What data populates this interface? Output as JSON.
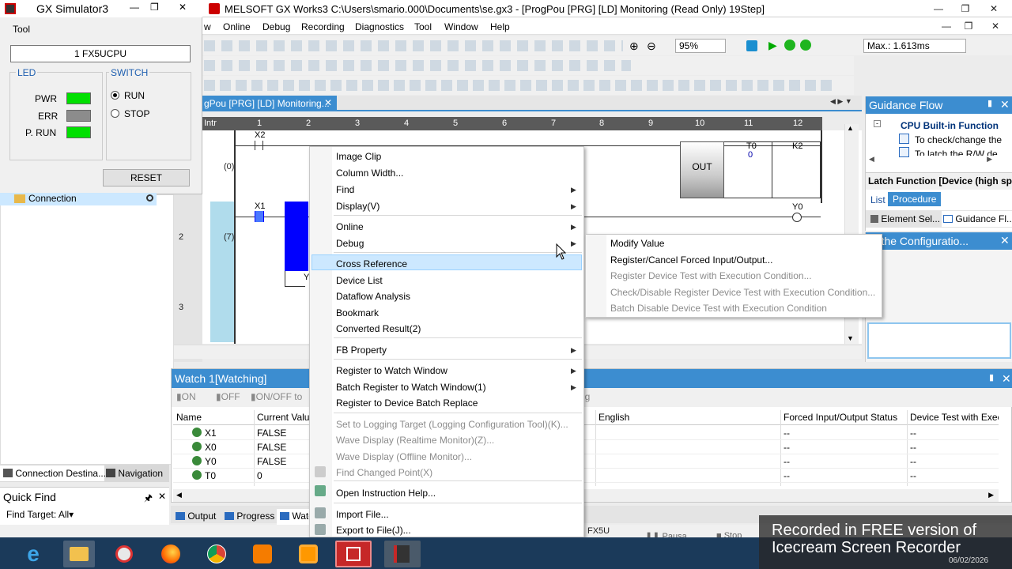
{
  "main_window": {
    "title": "MELSOFT GX Works3 C:\\Users\\smario.000\\Documents\\se.gx3 - [ProgPou [PRG] [LD] Monitoring (Read Only) 19Step]",
    "menu_items": [
      "w",
      "Online",
      "Debug",
      "Recording",
      "Diagnostics",
      "Tool",
      "Window",
      "Help"
    ],
    "zoom": "95%",
    "scan_time": "Max.: 1.613ms"
  },
  "simulator": {
    "title": "GX Simulator3",
    "tool_label": "Tool",
    "cpu": "1  FX5UCPU",
    "led_group": "LED",
    "switch_group": "SWITCH",
    "leds": [
      {
        "label": "PWR",
        "color": "#00e000"
      },
      {
        "label": "ERR",
        "color": "#8c8c8c"
      },
      {
        "label": "P. RUN",
        "color": "#00e000"
      }
    ],
    "run_label": "RUN",
    "stop_label": "STOP",
    "reset_label": "RESET"
  },
  "connection_item": "Connection",
  "tab": "gPou [PRG] [LD] Monitoring...",
  "ladder": {
    "ruler_first": "Intr",
    "columns": [
      "1",
      "2",
      "3",
      "4",
      "5",
      "6",
      "7",
      "8",
      "9",
      "10",
      "11",
      "12"
    ],
    "rows": [
      {
        "num": "1",
        "step": "(0)"
      },
      {
        "num": "2",
        "step": "(7)"
      },
      {
        "num": "3",
        "step": ""
      }
    ],
    "contact_x2": "X2",
    "contact_x1": "X1",
    "coil_y0": "Y0",
    "y_partial": "Y",
    "out_block": "OUT",
    "t0_label": "T0",
    "t0_value": "0",
    "k2_label": "K2"
  },
  "guidance": {
    "title": "Guidance Flow",
    "tree_root": "CPU Built-in Function",
    "tree_items": [
      "To check/change the",
      "To latch the R/W de"
    ],
    "heading": "Latch Function [Device (high speed",
    "tabs": [
      "List",
      "Procedure"
    ],
    "bottom_tabs": [
      "Element Sel...",
      "Guidance Fl..."
    ],
    "config_title": "ut the Configuratio..."
  },
  "watch": {
    "title": "Watch 1[Watching]",
    "toolbar": [
      "ON",
      "OFF",
      "ON/OFF to",
      "ng"
    ],
    "columns_left": [
      "Name",
      "Current Value"
    ],
    "columns_right": [
      "English",
      "Forced Input/Output Status",
      "Device Test with Exec"
    ],
    "rows": [
      {
        "name": "X1",
        "value": "FALSE",
        "forced": "--",
        "test": "--"
      },
      {
        "name": "X0",
        "value": "FALSE",
        "forced": "--",
        "test": "--"
      },
      {
        "name": "Y0",
        "value": "FALSE",
        "forced": "--",
        "test": "--"
      },
      {
        "name": "T0",
        "value": "0",
        "forced": "--",
        "test": "--"
      }
    ]
  },
  "context_menu": {
    "items": [
      {
        "label": "Image Clip",
        "arrow": false,
        "disabled": false
      },
      {
        "label": "Column Width...",
        "arrow": false,
        "disabled": false
      },
      {
        "label": "Find",
        "arrow": true,
        "disabled": false
      },
      {
        "label": "Display(V)",
        "arrow": true,
        "disabled": false
      },
      {
        "label": "Online",
        "arrow": true,
        "disabled": false
      },
      {
        "label": "Debug",
        "arrow": true,
        "disabled": false
      },
      {
        "label": "Cross Reference",
        "arrow": false,
        "disabled": false
      },
      {
        "label": "Device List",
        "arrow": false,
        "disabled": false
      },
      {
        "label": "Dataflow Analysis",
        "arrow": false,
        "disabled": false
      },
      {
        "label": "Bookmark",
        "arrow": false,
        "disabled": false
      },
      {
        "label": "Converted Result(2)",
        "arrow": false,
        "disabled": false
      },
      {
        "label": "FB Property",
        "arrow": true,
        "disabled": false
      },
      {
        "label": "Register to Watch Window",
        "arrow": true,
        "disabled": false
      },
      {
        "label": "Batch Register to Watch Window(1)",
        "arrow": true,
        "disabled": false
      },
      {
        "label": "Register to Device Batch Replace",
        "arrow": false,
        "disabled": false
      },
      {
        "label": "Set to Logging Target (Logging Configuration Tool)(K)...",
        "arrow": false,
        "disabled": true
      },
      {
        "label": "Wave Display (Realtime Monitor)(Z)...",
        "arrow": false,
        "disabled": true
      },
      {
        "label": "Wave Display (Offline Monitor)...",
        "arrow": false,
        "disabled": true
      },
      {
        "label": "Find Changed Point(X)",
        "arrow": false,
        "disabled": true
      },
      {
        "label": "Open Instruction Help...",
        "arrow": false,
        "disabled": false
      },
      {
        "label": "Import File...",
        "arrow": false,
        "disabled": false
      },
      {
        "label": "Export to File(J)...",
        "arrow": false,
        "disabled": false
      }
    ],
    "highlighted": "Cross Reference"
  },
  "debug_submenu": {
    "items": [
      {
        "label": "Modify Value",
        "disabled": false
      },
      {
        "label": "Register/Cancel Forced Input/Output...",
        "disabled": false
      },
      {
        "label": "Register Device Test with Execution Condition...",
        "disabled": true
      },
      {
        "label": "Check/Disable Register Device Test with Execution Condition...",
        "disabled": true
      },
      {
        "label": "Batch Disable Device Test with Execution Condition",
        "disabled": true
      }
    ]
  },
  "left_tabs": [
    "Connection Destina...",
    "Navigation"
  ],
  "quick_find": {
    "title": "Quick Find",
    "target": "Find Target: All"
  },
  "bottom_tabs": [
    "Output",
    "Progress",
    "Watc"
  ],
  "status": {
    "cpu": "FX5U",
    "pause": "Pausa",
    "stop": "Stop"
  },
  "watermark": {
    "line1": "Recorded in FREE version of",
    "line2": "Icecream Screen Recorder",
    "date": "06/02/2026"
  },
  "colors": {
    "selection": "#cce8ff",
    "selection_border": "#99d1ff",
    "led_on": "#00e000",
    "contact_blue": "#0000ff"
  }
}
